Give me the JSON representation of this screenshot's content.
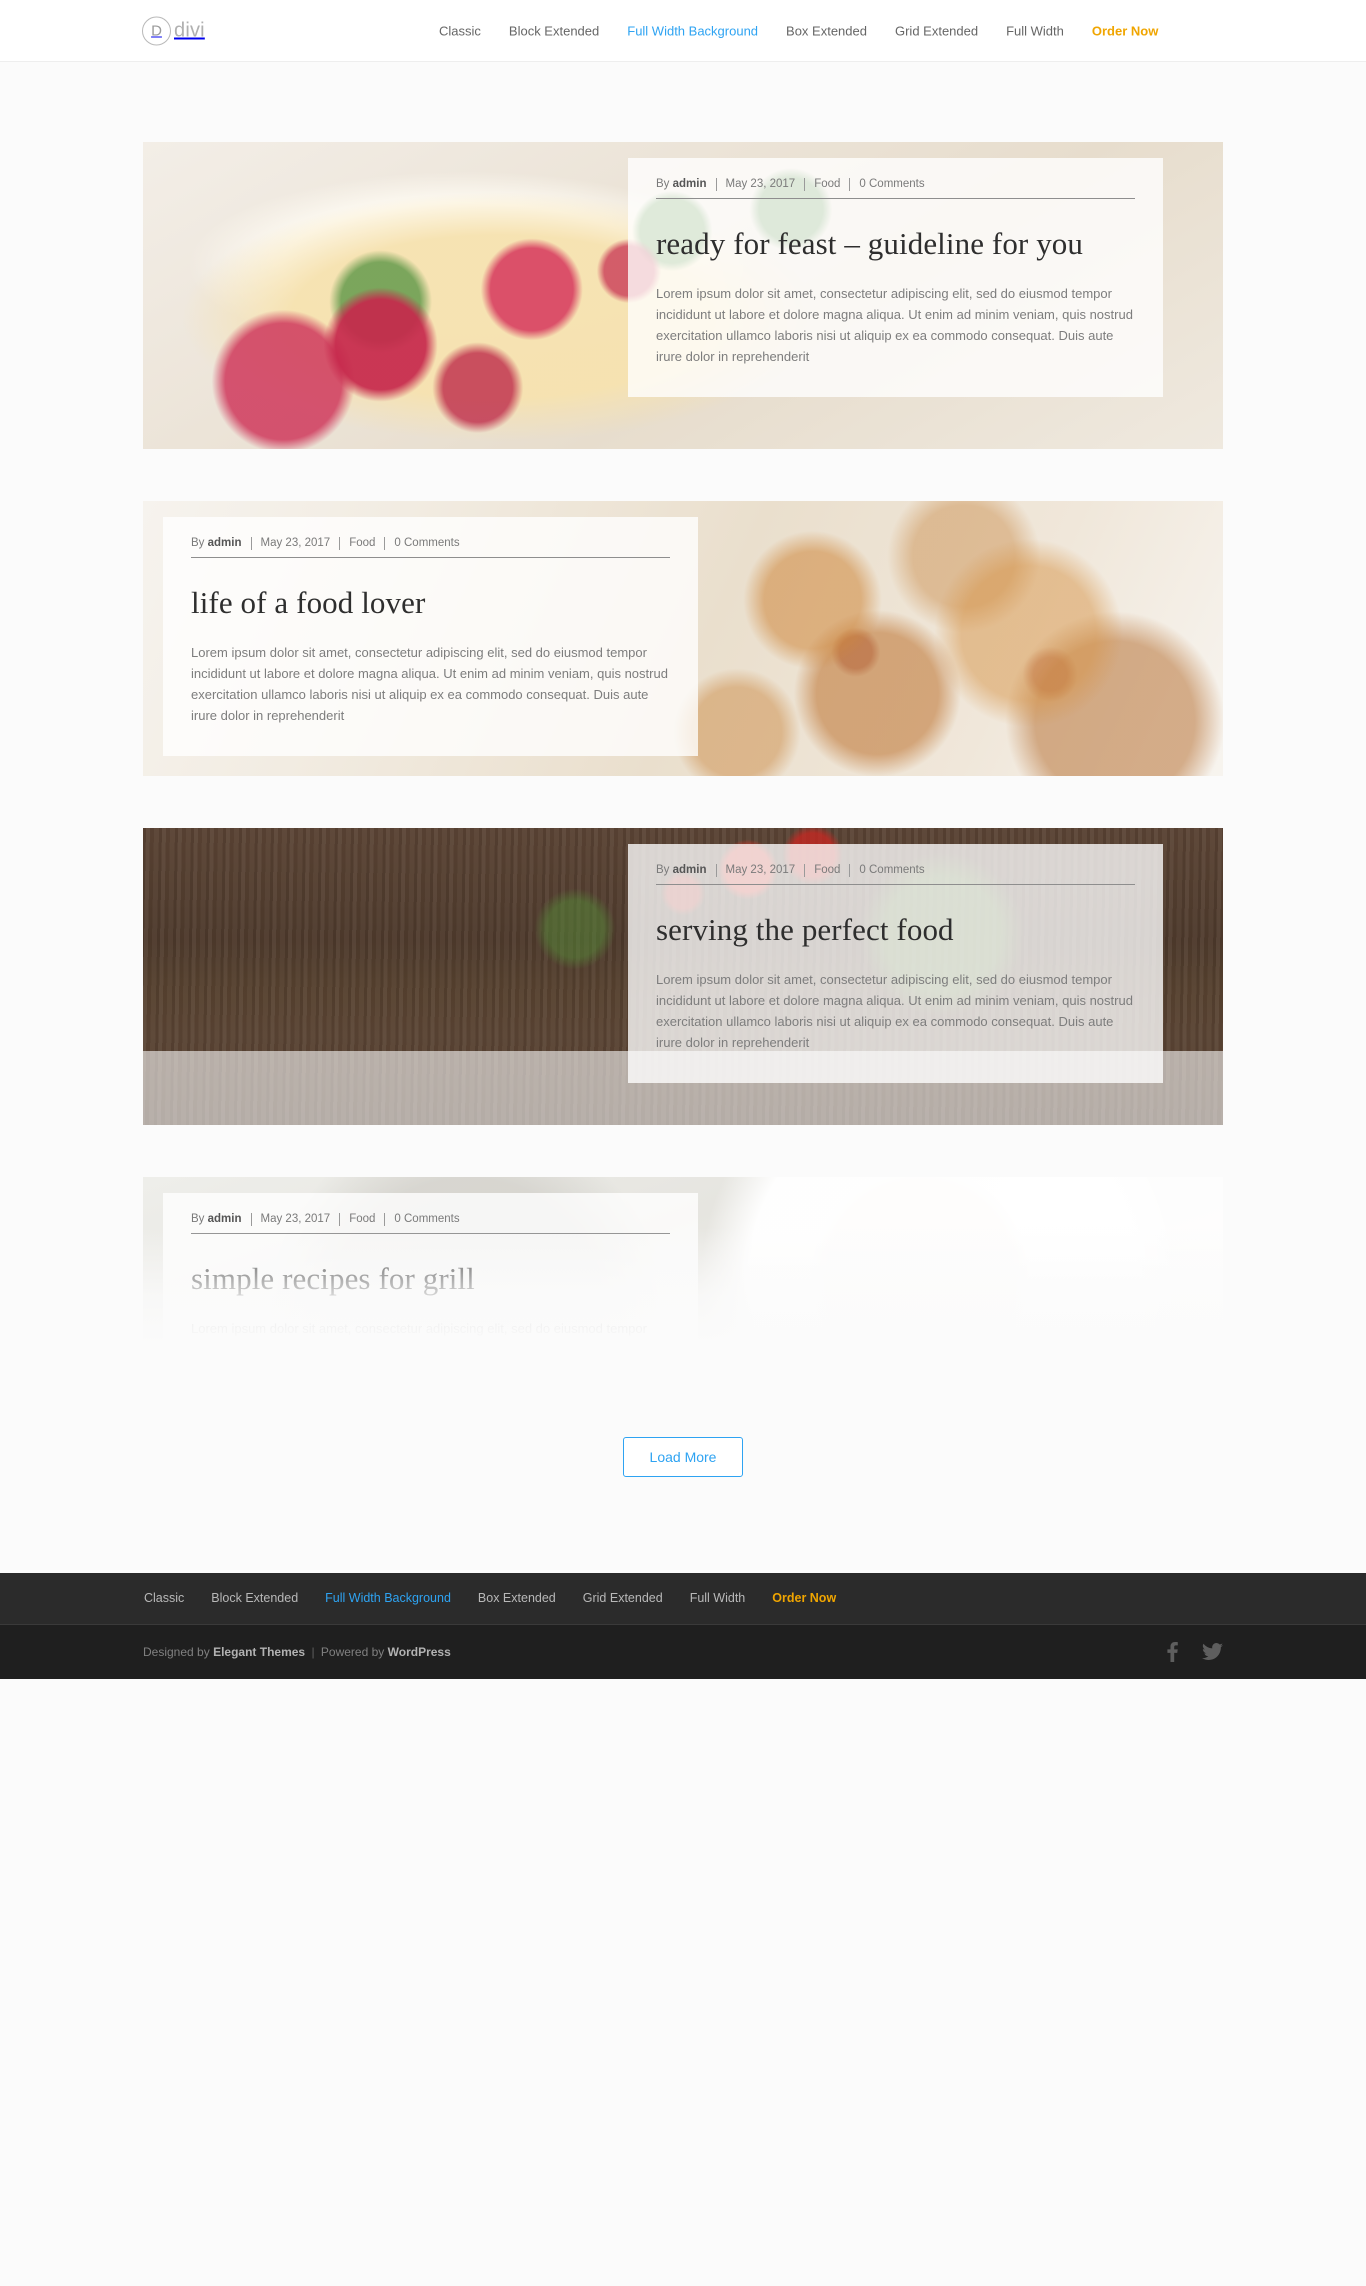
{
  "header": {
    "logo": {
      "mark": "D",
      "text": "divi",
      "icon": "divi-logo-icon"
    },
    "nav": [
      {
        "label": "Classic",
        "state": "default"
      },
      {
        "label": "Block Extended",
        "state": "default"
      },
      {
        "label": "Full Width Background",
        "state": "active"
      },
      {
        "label": "Box Extended",
        "state": "default"
      },
      {
        "label": "Grid Extended",
        "state": "default"
      },
      {
        "label": "Full Width",
        "state": "default"
      },
      {
        "label": "Order Now",
        "state": "cta"
      }
    ]
  },
  "posts": [
    {
      "meta": {
        "by_prefix": "By",
        "author": "admin",
        "date": "May 23, 2017",
        "category": "Food",
        "comments": "0 Comments"
      },
      "title": "ready for feast – guideline for you",
      "excerpt": "Lorem ipsum dolor sit amet, consectetur adipiscing elit, sed do eiusmod tempor incididunt ut labore et dolore magna aliqua. Ut enim ad minim veniam, quis nostrud exercitation ullamco laboris nisi ut aliquip ex ea commodo consequat. Duis aute irure dolor in reprehenderit",
      "panel_side": "right",
      "image_subject": "raspberry-pancake-stack"
    },
    {
      "meta": {
        "by_prefix": "By",
        "author": "admin",
        "date": "May 23, 2017",
        "category": "Food",
        "comments": "0 Comments"
      },
      "title": "life of a food lover",
      "excerpt": "Lorem ipsum dolor sit amet, consectetur adipiscing elit, sed do eiusmod tempor incididunt ut labore et dolore magna aliqua. Ut enim ad minim veniam, quis nostrud exercitation ullamco laboris nisi ut aliquip ex ea commodo consequat. Duis aute irure dolor in reprehenderit",
      "panel_side": "left",
      "image_subject": "puff-pastry-pinwheels"
    },
    {
      "meta": {
        "by_prefix": "By",
        "author": "admin",
        "date": "May 23, 2017",
        "category": "Food",
        "comments": "0 Comments"
      },
      "title": "serving the perfect food",
      "excerpt": "Lorem ipsum dolor sit amet, consectetur adipiscing elit, sed do eiusmod tempor incididunt ut labore et dolore magna aliqua. Ut enim ad minim veniam, quis nostrud exercitation ullamco laboris nisi ut aliquip ex ea commodo consequat. Duis aute irure dolor in reprehenderit",
      "panel_side": "right",
      "image_subject": "tomatoes-basil-on-wood"
    },
    {
      "meta": {
        "by_prefix": "By",
        "author": "admin",
        "date": "May 23, 2017",
        "category": "Food",
        "comments": "0 Comments"
      },
      "title": "simple recipes for grill",
      "excerpt": "Lorem ipsum dolor sit amet, consectetur adipiscing elit, sed do eiusmod tempor incididunt ut labore et dolore magna aliqua. Ut enim ad minim veniam, quis nostrud exercitation ullamco laboris nisi ut aliquip ex ea commodo consequat. Duis aute irure dolor in reprehenderit",
      "panel_side": "left",
      "image_subject": "chocolate-drizzled-cookie-on-plate"
    }
  ],
  "load_more": {
    "label": "Load More"
  },
  "footer": {
    "nav": [
      {
        "label": "Classic",
        "state": "default"
      },
      {
        "label": "Block Extended",
        "state": "default"
      },
      {
        "label": "Full Width Background",
        "state": "active"
      },
      {
        "label": "Box Extended",
        "state": "default"
      },
      {
        "label": "Grid Extended",
        "state": "default"
      },
      {
        "label": "Full Width",
        "state": "default"
      },
      {
        "label": "Order Now",
        "state": "cta"
      }
    ],
    "credit": {
      "designed_by": "Designed by",
      "theme": "Elegant Themes",
      "separator": "|",
      "powered_by": "Powered by",
      "platform": "WordPress"
    },
    "social": [
      {
        "name": "facebook-icon",
        "label": "Facebook"
      },
      {
        "name": "twitter-icon",
        "label": "Twitter"
      }
    ]
  },
  "colors": {
    "accent_blue": "#2ea3f2",
    "cta_orange": "#f0a500",
    "page_bg": "#fbfbfb",
    "footer_nav_bg": "#2b2b2b",
    "footer_bottom_bg": "#1f1f1f"
  }
}
